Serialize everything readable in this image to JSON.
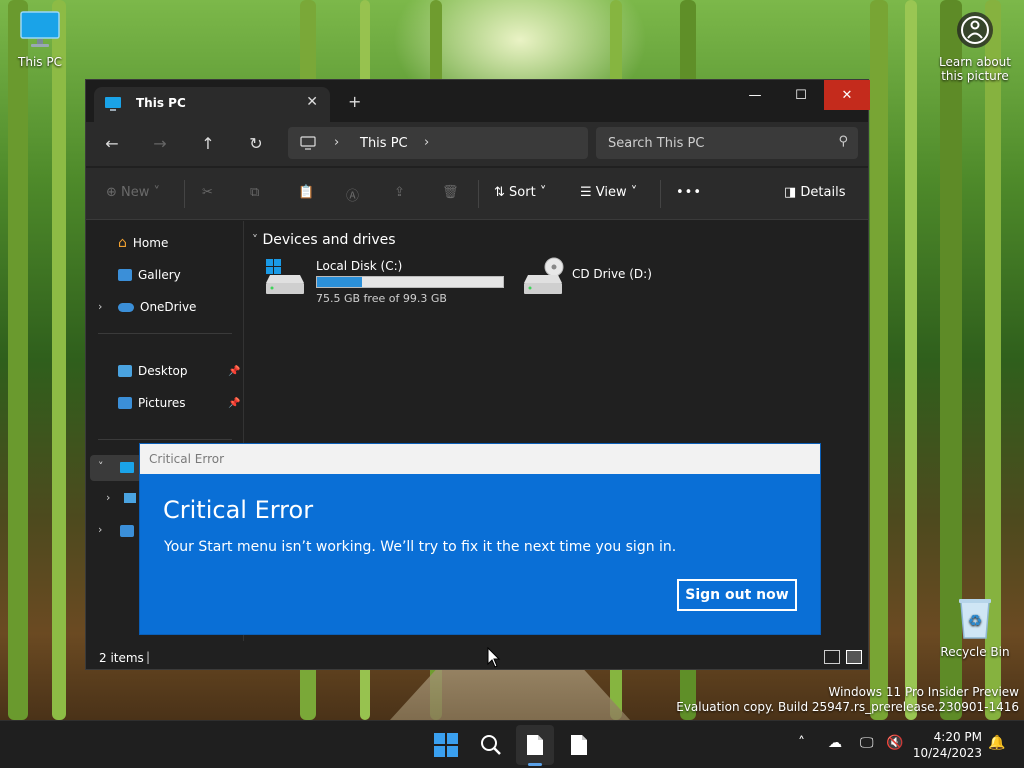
{
  "desktop": {
    "icons": [
      {
        "label": "This PC"
      },
      {
        "label": "Learn about this picture"
      },
      {
        "label": "Recycle Bin"
      }
    ],
    "watermark": {
      "line1": "Windows 11 Pro Insider Preview",
      "line2": "Evaluation copy. Build 25947.rs_prerelease.230901-1416"
    }
  },
  "explorer": {
    "tab_title": "This PC",
    "tab_close": "✕",
    "tab_add": "+",
    "window_buttons": {
      "minimize": "—",
      "maximize": "☐",
      "close": "✕"
    },
    "breadcrumb": "This PC",
    "search_placeholder": "Search This PC",
    "toolbar": {
      "new": "New",
      "sort": "Sort",
      "view": "View",
      "more": "•••",
      "details": "Details"
    },
    "sidebar": {
      "home": "Home",
      "gallery": "Gallery",
      "onedrive": "OneDrive",
      "desktop": "Desktop",
      "pictures": "Pictures"
    },
    "group_header": "Devices and drives",
    "drives": [
      {
        "name": "Local Disk (C:)",
        "free_text": "75.5 GB free of 99.3 GB",
        "used_fraction": 0.24
      },
      {
        "name": "CD Drive (D:)"
      }
    ],
    "status": "2 items"
  },
  "dialog": {
    "window_title": "Critical Error",
    "heading": "Critical Error",
    "message": "Your Start menu isn’t working. We’ll try to fix it the next time you sign in.",
    "button": "Sign out now"
  },
  "taskbar": {
    "time": "4:20 PM",
    "date": "10/24/2023"
  },
  "colors": {
    "dialog_blue": "#0a6fd6",
    "accent": "#2b90d9"
  }
}
